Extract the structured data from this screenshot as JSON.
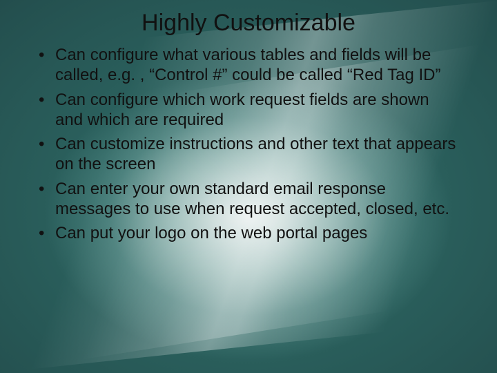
{
  "title": "Highly Customizable",
  "bullets": [
    "Can configure what various tables and fields will be called, e.g. , “Control #” could be called “Red Tag ID”",
    "Can configure which work request fields are shown and which are required",
    "Can customize instructions and other text that appears on the screen",
    "Can enter your own standard email response messages to use when request accepted, closed, etc.",
    "Can put your logo on the web portal pages"
  ]
}
